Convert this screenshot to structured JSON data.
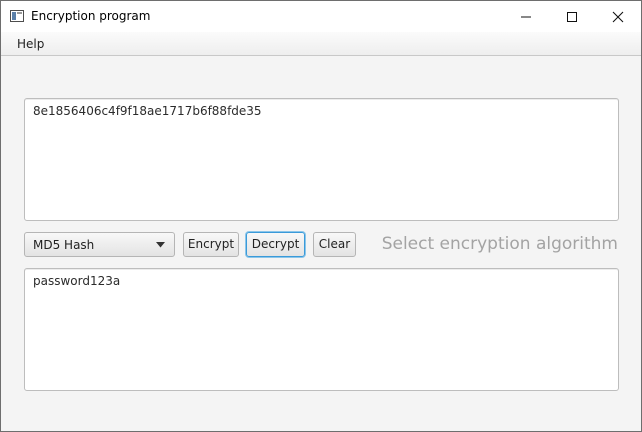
{
  "window": {
    "title": "Encryption program",
    "icon": "app-window-icon",
    "controls": [
      "minimize-icon",
      "maximize-icon",
      "close-icon"
    ]
  },
  "menu": {
    "items": [
      {
        "label": "Help"
      }
    ]
  },
  "input_area": {
    "value": "8e1856406c4f9f18ae1717b6f88fde35"
  },
  "controls": {
    "algorithm_select": {
      "selected": "MD5 Hash"
    },
    "encrypt_label": "Encrypt",
    "decrypt_label": "Decrypt",
    "clear_label": "Clear",
    "hint": "Select encryption algorithm"
  },
  "output_area": {
    "value": "password123a"
  },
  "colors": {
    "focus_border": "#3a9ad9",
    "hint_text": "#a3a3a3",
    "background": "#f4f4f4"
  }
}
